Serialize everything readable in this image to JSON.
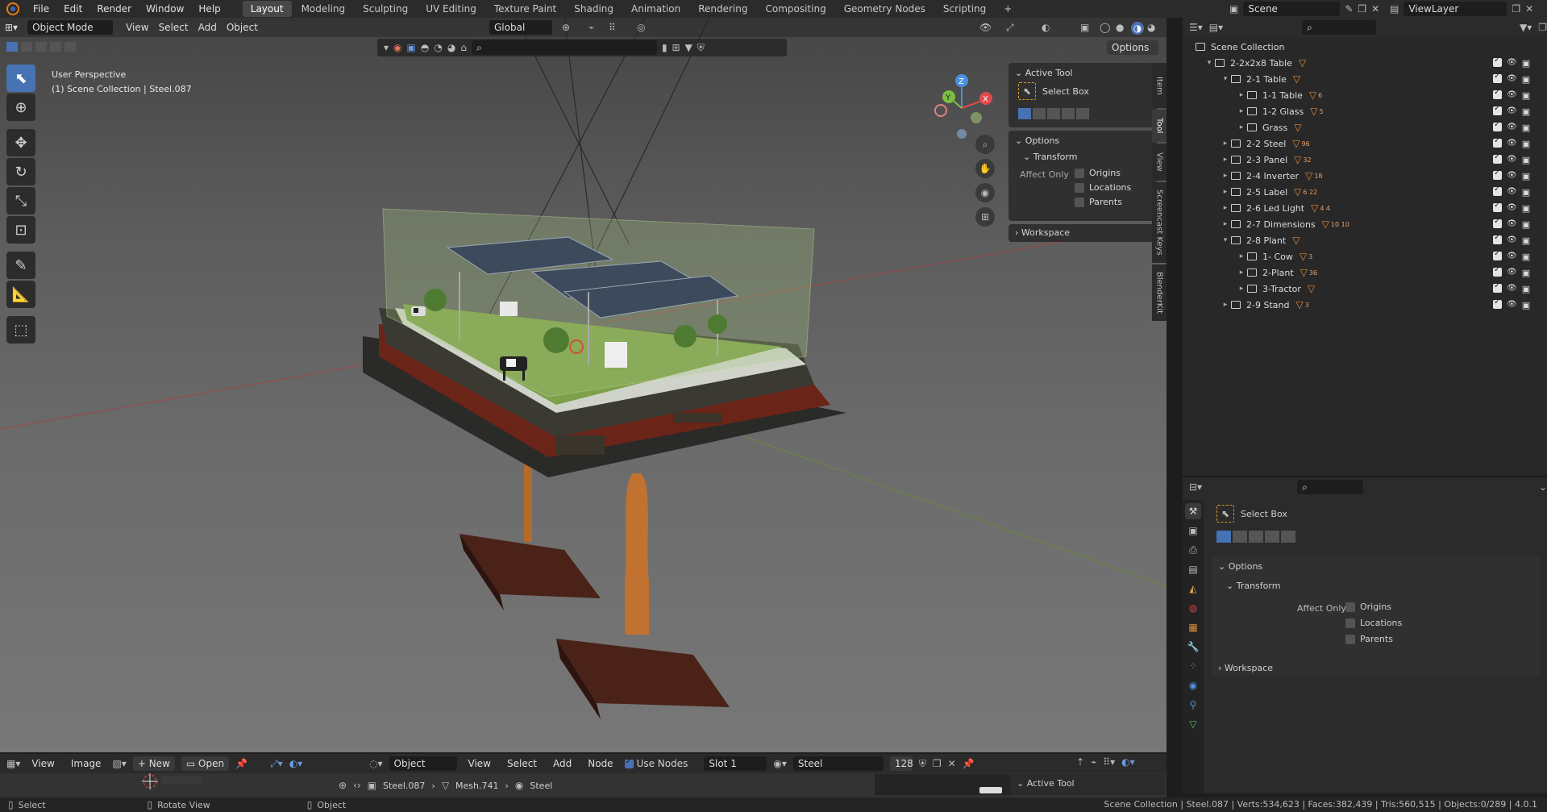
{
  "topbar": {
    "menus": [
      "File",
      "Edit",
      "Render",
      "Window",
      "Help"
    ],
    "workspaces": [
      "Layout",
      "Modeling",
      "Sculpting",
      "UV Editing",
      "Texture Paint",
      "Shading",
      "Animation",
      "Rendering",
      "Compositing",
      "Geometry Nodes",
      "Scripting"
    ],
    "active_workspace": "Layout",
    "add_tab": "+",
    "scene": "Scene",
    "view_layer": "ViewLayer"
  },
  "viewport": {
    "mode": "Object Mode",
    "menus": [
      "View",
      "Select",
      "Add",
      "Object"
    ],
    "orientation": "Global",
    "options": "Options",
    "overlay_line1": "User Perspective",
    "overlay_line2": "(1) Scene Collection | Steel.087",
    "gizmo_labels": {
      "z": "Z",
      "y": "Y",
      "x": "X"
    }
  },
  "npanel": {
    "active_tool_header": "Active Tool",
    "tool_name": "Select Box",
    "options_header": "Options",
    "transform_header": "Transform",
    "affect_only": "Affect Only",
    "opt_origins": "Origins",
    "opt_locations": "Locations",
    "opt_parents": "Parents",
    "workspace_header": "Workspace",
    "side_tabs": [
      "Item",
      "Tool",
      "View",
      "Screencast Keys",
      "BlenderKit"
    ]
  },
  "outliner": {
    "search_placeholder": "",
    "root": "Scene Collection",
    "rows": [
      {
        "label": "2-2x2x8 Table",
        "depth": 1,
        "open": true,
        "badge": ""
      },
      {
        "label": "2-1 Table",
        "depth": 2,
        "open": true,
        "badge": ""
      },
      {
        "label": "1-1 Table",
        "depth": 3,
        "open": false,
        "badge": "6"
      },
      {
        "label": "1-2 Glass",
        "depth": 3,
        "open": false,
        "badge": "5"
      },
      {
        "label": "Grass",
        "depth": 3,
        "open": false,
        "badge": ""
      },
      {
        "label": "2-2 Steel",
        "depth": 2,
        "open": false,
        "badge": "96"
      },
      {
        "label": "2-3 Panel",
        "depth": 2,
        "open": false,
        "badge": "32"
      },
      {
        "label": "2-4 Inverter",
        "depth": 2,
        "open": false,
        "badge": "18"
      },
      {
        "label": "2-5 Label",
        "depth": 2,
        "open": false,
        "badge": "6  22"
      },
      {
        "label": "2-6 Led Light",
        "depth": 2,
        "open": false,
        "badge": "4  4"
      },
      {
        "label": "2-7 Dimensions",
        "depth": 2,
        "open": false,
        "badge": "10  10"
      },
      {
        "label": "2-8 Plant",
        "depth": 2,
        "open": true,
        "badge": ""
      },
      {
        "label": "1- Cow",
        "depth": 3,
        "open": false,
        "badge": "3"
      },
      {
        "label": "2-Plant",
        "depth": 3,
        "open": false,
        "badge": "36"
      },
      {
        "label": "3-Tractor",
        "depth": 3,
        "open": false,
        "badge": ""
      },
      {
        "label": "2-9 Stand",
        "depth": 2,
        "open": false,
        "badge": "3"
      }
    ]
  },
  "properties": {
    "tool_name": "Select Box",
    "options_header": "Options",
    "transform_header": "Transform",
    "affect_only": "Affect Only",
    "opt_origins": "Origins",
    "opt_locations": "Locations",
    "opt_parents": "Parents",
    "workspace_header": "Workspace"
  },
  "image_editor": {
    "menus": [
      "View",
      "Image"
    ],
    "new": "New",
    "open": "Open"
  },
  "shader_editor": {
    "type": "Object",
    "menus": [
      "View",
      "Select",
      "Add",
      "Node"
    ],
    "use_nodes": "Use Nodes",
    "slot": "Slot 1",
    "material": "Steel",
    "users": "128",
    "breadcrumb": [
      "Steel.087",
      "Mesh.741",
      "Steel"
    ],
    "active_tool": "Active Tool"
  },
  "status": {
    "left": [
      "Select",
      "Rotate View",
      "Object"
    ],
    "right": "Scene Collection | Steel.087 | Verts:534,623 | Faces:382,439 | Tris:560,515 | Objects:0/289 | 4.0.1"
  },
  "colors": {
    "accent": "#4772b3",
    "orange": "#e08a3c",
    "grid_red": "#9a4848",
    "grid_green": "#6a8a3a"
  }
}
